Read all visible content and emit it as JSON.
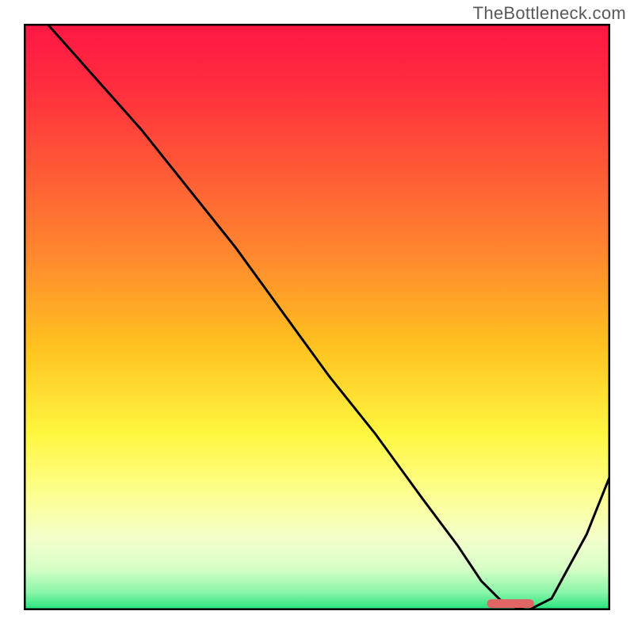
{
  "attribution": "TheBottleneck.com",
  "colors": {
    "curve": "#000000",
    "border": "#000000",
    "marker": "#e06666",
    "attribution_text": "#595959",
    "gradient_stops": [
      {
        "offset": 0.0,
        "color": "#ff1744"
      },
      {
        "offset": 0.1,
        "color": "#ff2b3e"
      },
      {
        "offset": 0.25,
        "color": "#ff5a36"
      },
      {
        "offset": 0.4,
        "color": "#ff8a2e"
      },
      {
        "offset": 0.55,
        "color": "#ffc21f"
      },
      {
        "offset": 0.7,
        "color": "#fff740"
      },
      {
        "offset": 0.8,
        "color": "#fdff8f"
      },
      {
        "offset": 0.88,
        "color": "#f3ffcc"
      },
      {
        "offset": 0.93,
        "color": "#d6ffc5"
      },
      {
        "offset": 0.97,
        "color": "#88f5a8"
      },
      {
        "offset": 1.0,
        "color": "#22e27a"
      }
    ]
  },
  "chart_data": {
    "type": "line",
    "title": "",
    "xlabel": "",
    "ylabel": "",
    "xlim": [
      0,
      100
    ],
    "ylim": [
      0,
      100
    ],
    "legend": false,
    "grid": false,
    "series": [
      {
        "name": "bottleneck-curve",
        "x": [
          4,
          12,
          20,
          24,
          28,
          36,
          44,
          52,
          60,
          68,
          74,
          78,
          82,
          86,
          90,
          96,
          100
        ],
        "y": [
          100,
          91,
          82,
          77,
          72,
          62,
          51,
          40,
          30,
          19,
          11,
          5,
          1,
          0,
          2,
          13,
          23
        ]
      }
    ],
    "marker": {
      "name": "optimal-range",
      "x_start": 79,
      "x_end": 87,
      "y": 1.2
    }
  }
}
